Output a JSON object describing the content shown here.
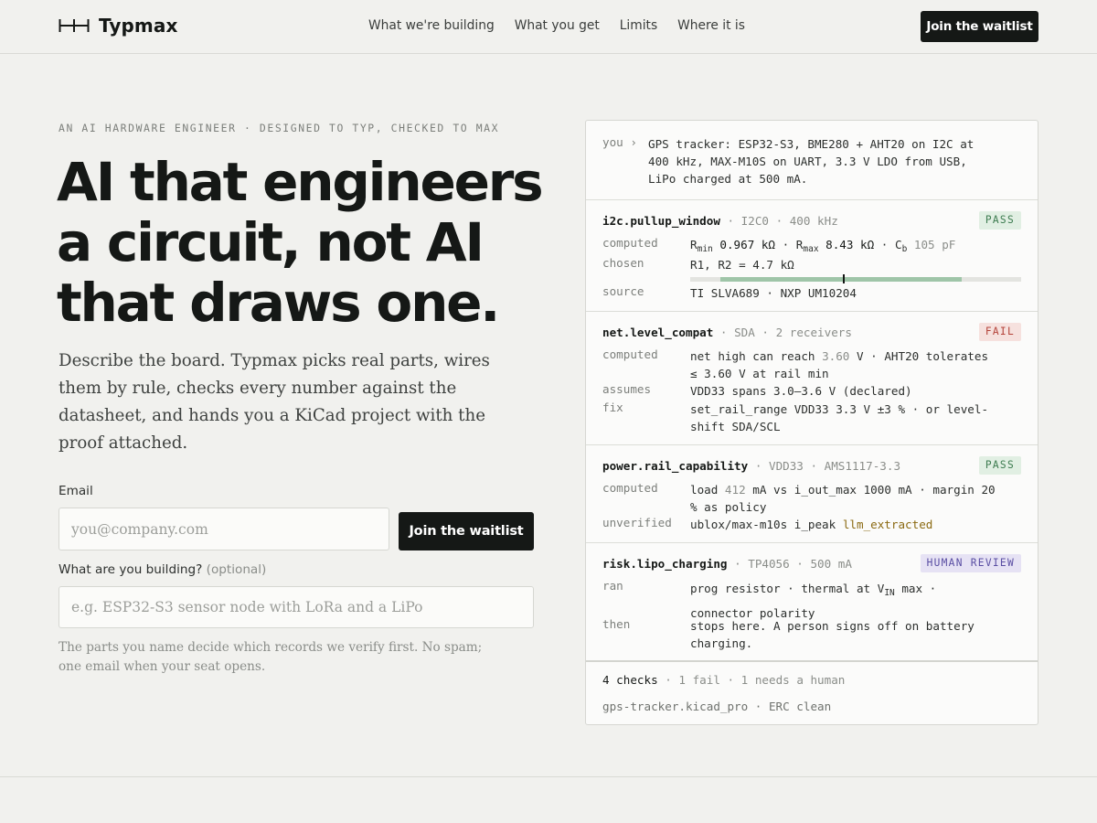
{
  "nav": {
    "brand": "Typmax",
    "links": [
      "What we're building",
      "What you get",
      "Limits",
      "Where it is"
    ],
    "cta": "Join the waitlist"
  },
  "hero": {
    "eyebrow": "AN AI HARDWARE ENGINEER · DESIGNED TO TYP, CHECKED TO MAX",
    "headline": [
      "AI that engineers",
      "a circuit, not AI",
      "that draws one."
    ],
    "lede": [
      "Describe the board. Typmax picks real parts, wires",
      "them by rule, checks every number against the",
      "datasheet, and hands you a KiCad project with the",
      "proof attached."
    ]
  },
  "form": {
    "email_label": "Email",
    "email_placeholder": "you@company.com",
    "submit": "Join the waitlist",
    "build_label": "What are you building?",
    "build_optional": "(optional)",
    "build_placeholder": "e.g. ESP32-S3 sensor node with LoRa and a LiPo",
    "fine_print": [
      "The parts you name decide which records we verify first. No spam;",
      "one email when your seat opens."
    ]
  },
  "panel": {
    "prompt_who": "you ›",
    "prompt_lines": [
      "GPS tracker: ESP32-S3, BME280 + AHT20 on I2C at",
      "400 kHz, MAX-M10S on UART, 3.3 V LDO from USB,",
      "LiPo charged at 500 mA."
    ],
    "checks": [
      {
        "name": "i2c.pullup_window",
        "meta": " · I2C0 · 400 kHz",
        "badge": "PASS",
        "computed_key": "computed",
        "computed_rmin": "0.967 kΩ",
        "computed_rmax": "8.43 kΩ",
        "computed_cb": "105 pF",
        "chosen_key": "chosen",
        "chosen": "R1, R2 = 4.7 kΩ",
        "window_fill_start": 0.09,
        "window_fill_end": 0.82,
        "window_marker": 0.46,
        "source_key": "source",
        "source": "TI SLVA689 · NXP UM10204"
      },
      {
        "name": "net.level_compat",
        "meta": " · SDA · 2 receivers",
        "badge": "FAIL",
        "computed_key": "computed",
        "computed_a": "net high can reach ",
        "computed_val": "3.60",
        "computed_b": " V · AHT20 tolerates",
        "computed_line2": "≤ 3.60 V at rail min",
        "assumes_key": "assumes",
        "assumes": "VDD33 spans 3.0–3.6 V (declared)",
        "fix_key": "fix",
        "fix_line1": "set_rail_range VDD33 3.3 V ±3 % · or level-",
        "fix_line2": "shift SDA/SCL"
      },
      {
        "name": "power.rail_capability",
        "meta": " · VDD33 · AMS1117-3.3",
        "badge": "PASS",
        "computed_key": "computed",
        "computed_a": "load ",
        "computed_val": "412",
        "computed_b": " mA vs i_out_max 1000 mA · margin 20",
        "computed_line2": "% as policy",
        "unverified_key": "unverified",
        "unverified_a": "ublox/max-m10s i_peak ",
        "unverified_b": "llm_extracted"
      },
      {
        "name": "risk.lipo_charging",
        "meta": " · TP4056 · 500 mA",
        "badge": "HUMAN REVIEW",
        "ran_key": "ran",
        "ran_a": "prog resistor · thermal at V",
        "ran_sub": "IN",
        "ran_b": " max ·",
        "ran_line2": "connector polarity",
        "then_key": "then",
        "then_line1": "stops here. A person signs off on battery",
        "then_line2": "charging."
      }
    ],
    "summary_count": "4 checks",
    "summary_rest": " · 1 fail · 1 needs a human",
    "artifact": "gps-tracker.kicad_pro · ERC clean"
  }
}
